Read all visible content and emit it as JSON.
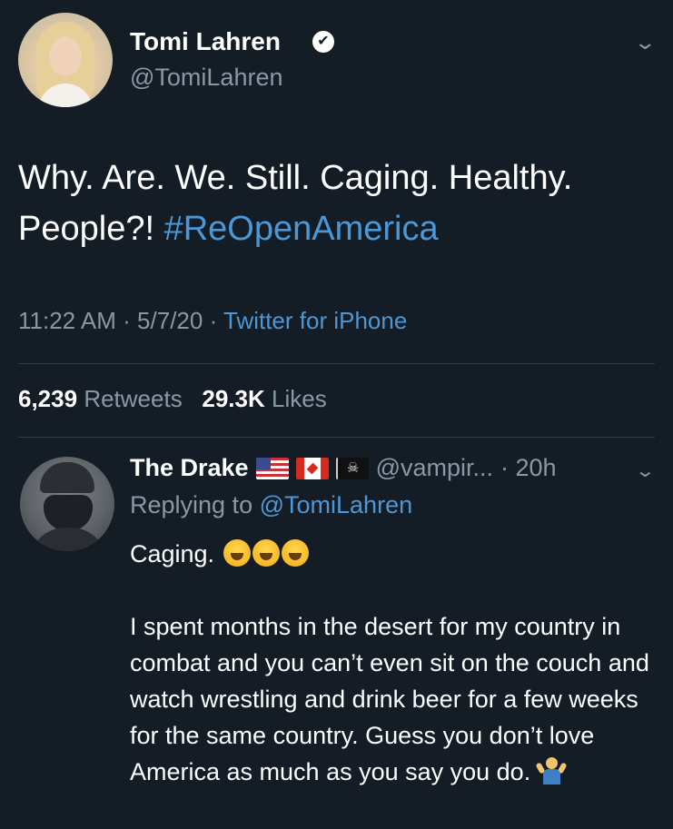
{
  "tweet": {
    "author": {
      "display_name": "Tomi Lahren",
      "handle": "@TomiLahren",
      "verified": true
    },
    "text": "Why. Are. We. Still. Caging. Healthy. People?! ",
    "hashtag": "#ReOpenAmerica",
    "time": "11:22 AM",
    "date": "5/7/20",
    "source": "Twitter for iPhone",
    "meta_separator": " · ",
    "retweets_count": "6,239",
    "retweets_label": "Retweets",
    "likes_count": "29.3K",
    "likes_label": "Likes"
  },
  "reply": {
    "author": {
      "display_name": "The Drake",
      "handle": "@vampir...",
      "flags": [
        "us-flag",
        "canada-flag",
        "pirate-flag"
      ]
    },
    "age": "· 20h",
    "replying_to_label": "Replying to",
    "replying_to_handle": "@TomiLahren",
    "line1": "Caging.",
    "line1_emoji": [
      "face-with-tears-of-joy",
      "face-with-tears-of-joy",
      "face-with-tears-of-joy"
    ],
    "body": "I spent months in the desert for my country in combat and you can’t even sit on the couch and watch wrestling and drink beer for a few weeks for the same country. Guess you don’t love America as much as you say you do.",
    "body_emoji": "person-shrugging"
  },
  "icons": {
    "verified_glyph": "✔",
    "chevron_glyph": "⌄",
    "pirate_glyph": "☠"
  },
  "colors": {
    "background": "#141d26",
    "link": "#4c97d6",
    "muted": "#8899a6",
    "divider": "#2c3a47"
  }
}
